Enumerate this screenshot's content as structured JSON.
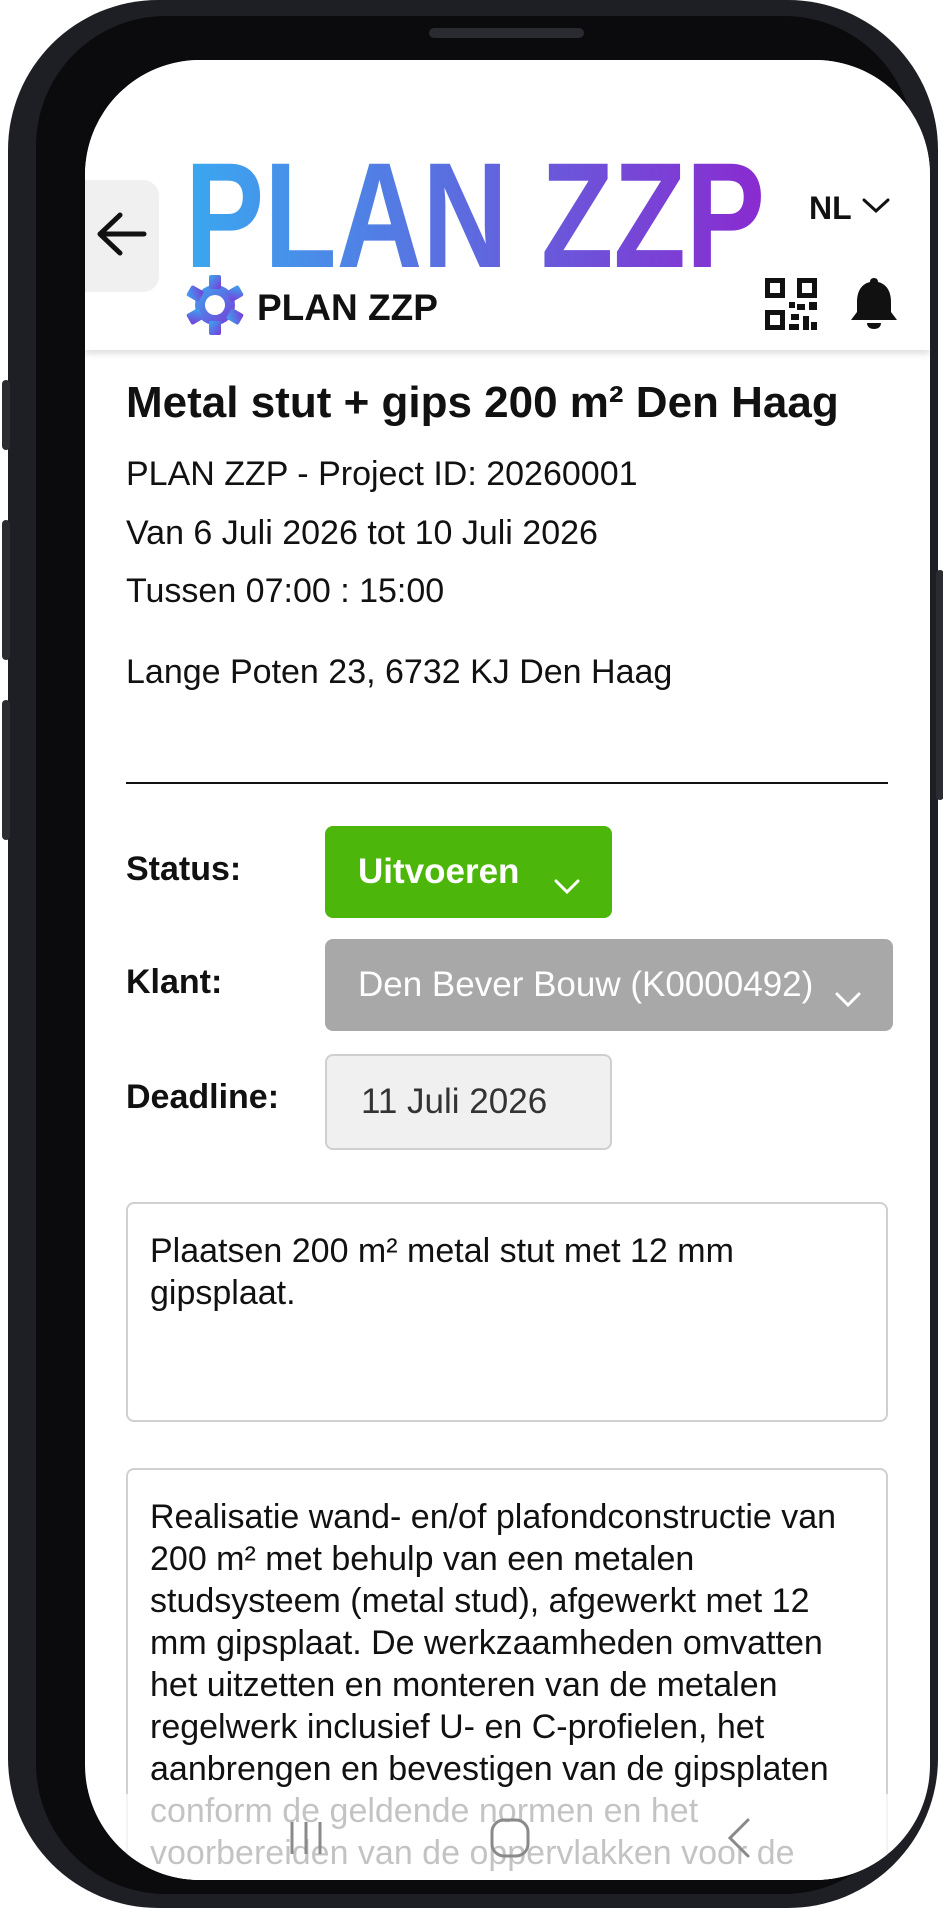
{
  "header": {
    "logo_text": "PLAN ZZP",
    "sub_logo_text": "PLAN ZZP",
    "language": "NL",
    "icons": [
      "back-arrow-icon",
      "qr-code-icon",
      "bell-icon",
      "gear-icon",
      "chevron-down-icon"
    ]
  },
  "project": {
    "title": "Metal stut + gips 200 m² Den Haag",
    "project_id_line": "PLAN ZZP - Project ID: 20260001",
    "date_range": "Van 6 Juli 2026 tot 10 Juli 2026",
    "time_range": "Tussen 07:00 : 15:00",
    "address": "Lange Poten 23, 6732 KJ Den Haag"
  },
  "fields": {
    "status_label": "Status:",
    "status_value": "Uitvoeren",
    "client_label": "Klant:",
    "client_value": "Den Bever Bouw (K0000492)",
    "deadline_label": "Deadline:",
    "deadline_value": "11 Juli 2026"
  },
  "summary": "Plaatsen 200 m² metal stut met 12 mm gipsplaat.",
  "description": "Realisatie wand- en/of plafondconstructie van 200 m² met behulp van een metalen studsysteem (metal stud), afgewerkt met 12 mm gipsplaat. De werkzaamheden omvatten het uitzetten en monteren van de metalen regelwerk inclusief U- en C-profielen, het aanbrengen en bevestigen van de gipsplaten conform de geldende normen en het voorbereiden van de oppervlakken voor de",
  "colors": {
    "status_green": "#4cb60a",
    "client_gray": "#a8a8a8",
    "logo_gradient_start": "#3aa8f0",
    "logo_gradient_end": "#8a2ad0"
  }
}
